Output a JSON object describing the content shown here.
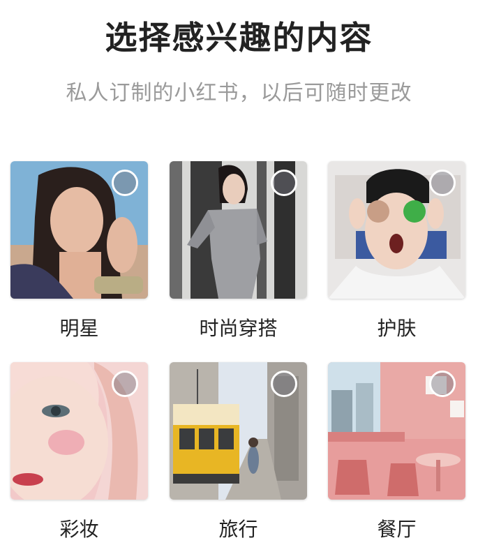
{
  "header": {
    "title": "选择感兴趣的内容",
    "subtitle": "私人订制的小红书，以后可随时更改"
  },
  "categories": [
    {
      "label": "明星",
      "selected": false
    },
    {
      "label": "时尚穿搭",
      "selected": false
    },
    {
      "label": "护肤",
      "selected": false
    },
    {
      "label": "彩妆",
      "selected": false
    },
    {
      "label": "旅行",
      "selected": false
    },
    {
      "label": "餐厅",
      "selected": false
    }
  ],
  "colors": {
    "title": "#222222",
    "subtitle": "#9a9a9a",
    "check_border": "#ffffff"
  }
}
